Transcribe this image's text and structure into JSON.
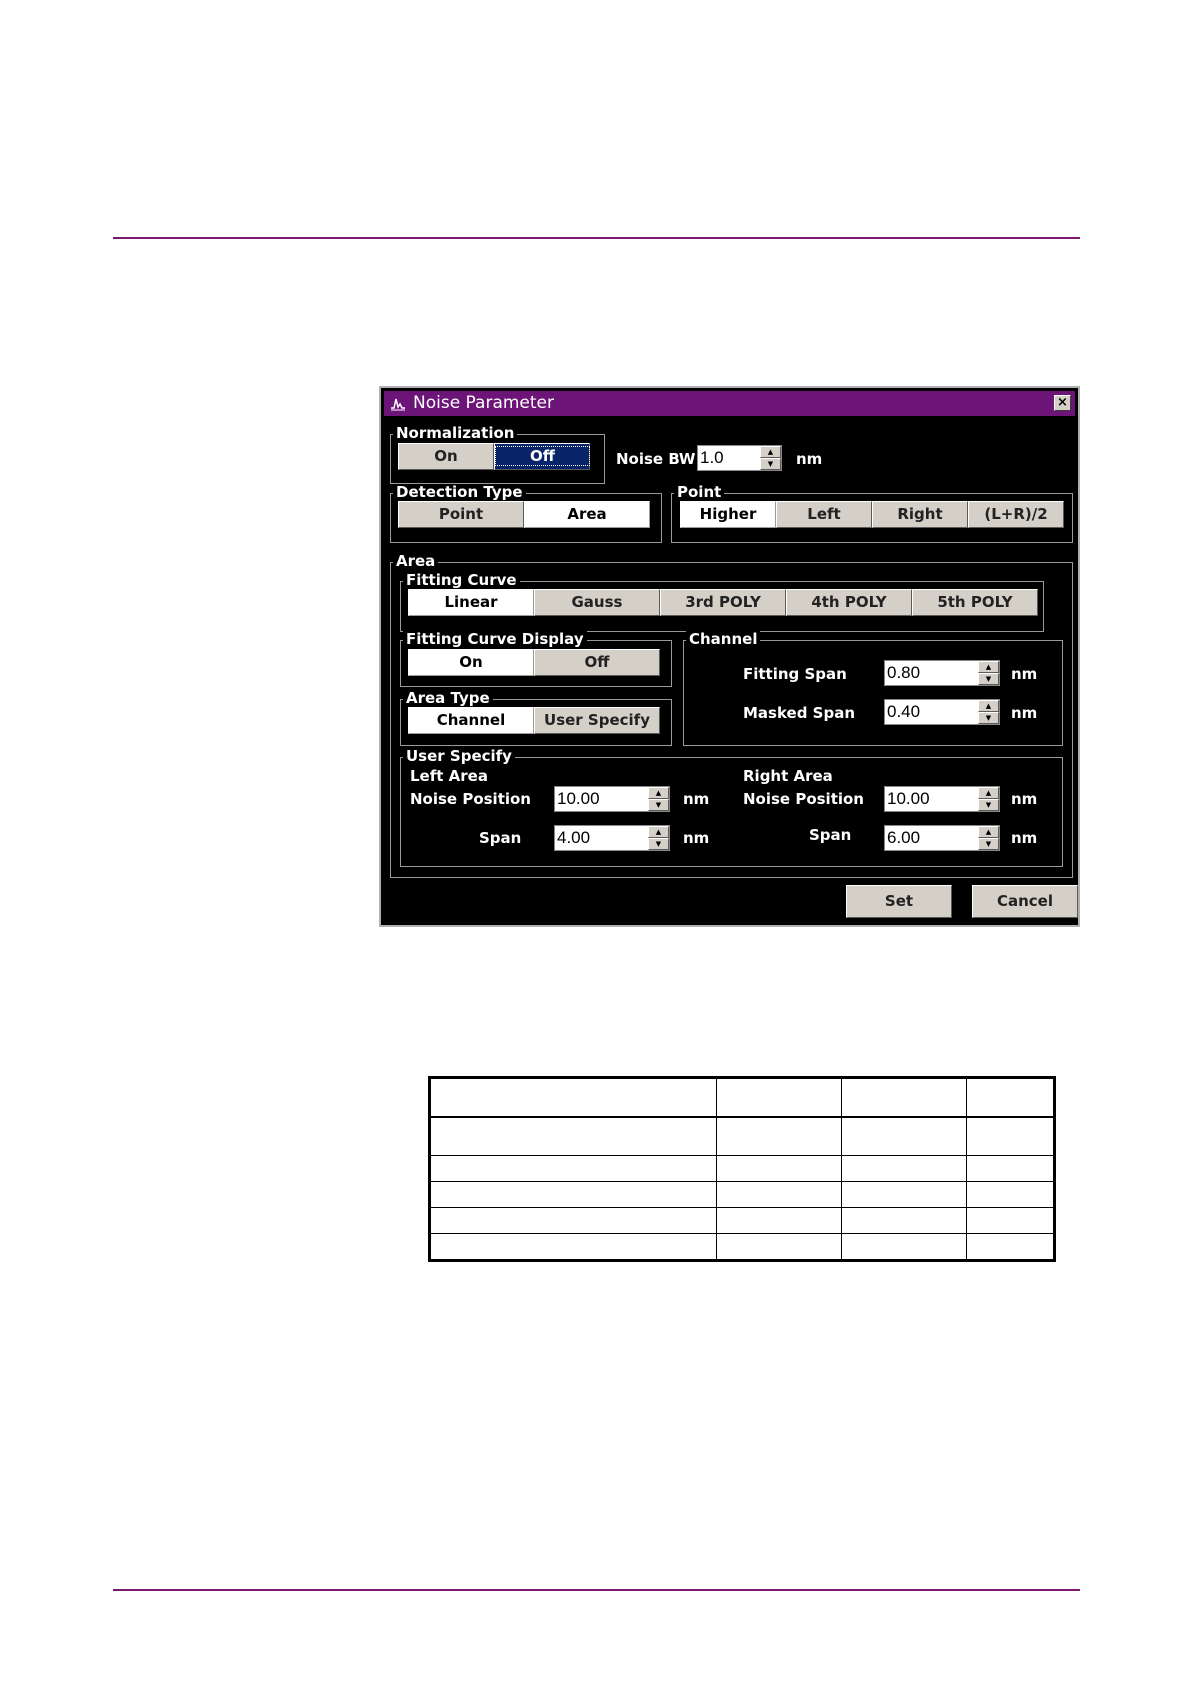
{
  "dialog": {
    "title": "Noise Parameter",
    "close_glyph": "×",
    "normalization": {
      "label": "Normalization",
      "on": "On",
      "off": "Off",
      "selected": "Off"
    },
    "noise_bw": {
      "label": "Noise BW",
      "value": "1.0",
      "unit": "nm"
    },
    "detection_type": {
      "label": "Detection Type",
      "point": "Point",
      "area": "Area",
      "selected": "Area"
    },
    "point": {
      "label": "Point",
      "higher": "Higher",
      "left": "Left",
      "right": "Right",
      "lr2": "(L+R)/2",
      "selected": "Higher"
    },
    "area": {
      "label": "Area",
      "fitting_curve": {
        "label": "Fitting Curve",
        "options": [
          "Linear",
          "Gauss",
          "3rd POLY",
          "4th POLY",
          "5th POLY"
        ],
        "selected": "Linear"
      },
      "fitting_curve_display": {
        "label": "Fitting Curve Display",
        "on": "On",
        "off": "Off",
        "selected": "On"
      },
      "area_type": {
        "label": "Area Type",
        "channel": "Channel",
        "user_specify": "User Specify",
        "selected": "Channel"
      },
      "channel": {
        "label": "Channel",
        "fitting_span_label": "Fitting Span",
        "fitting_span_value": "0.80",
        "masked_span_label": "Masked Span",
        "masked_span_value": "0.40",
        "unit": "nm"
      },
      "user_specify": {
        "label": "User Specify",
        "left_area": "Left Area",
        "right_area": "Right Area",
        "noise_position_label": "Noise Position",
        "span_label": "Span",
        "left_noise_position": "10.00",
        "left_span": "4.00",
        "right_noise_position": "10.00",
        "right_span": "6.00",
        "unit": "nm"
      }
    },
    "set_label": "Set",
    "cancel_label": "Cancel"
  },
  "icons": {
    "app": "spectrum-icon",
    "close": "close-icon",
    "spin_up": "spin-up-icon",
    "spin_down": "spin-down-icon"
  },
  "spin_glyphs": {
    "up": "▲",
    "down": "▼"
  },
  "colors": {
    "title_bar": "#6c1478",
    "rule": "#7a1a6e",
    "selected_navy": "#0a246a"
  }
}
